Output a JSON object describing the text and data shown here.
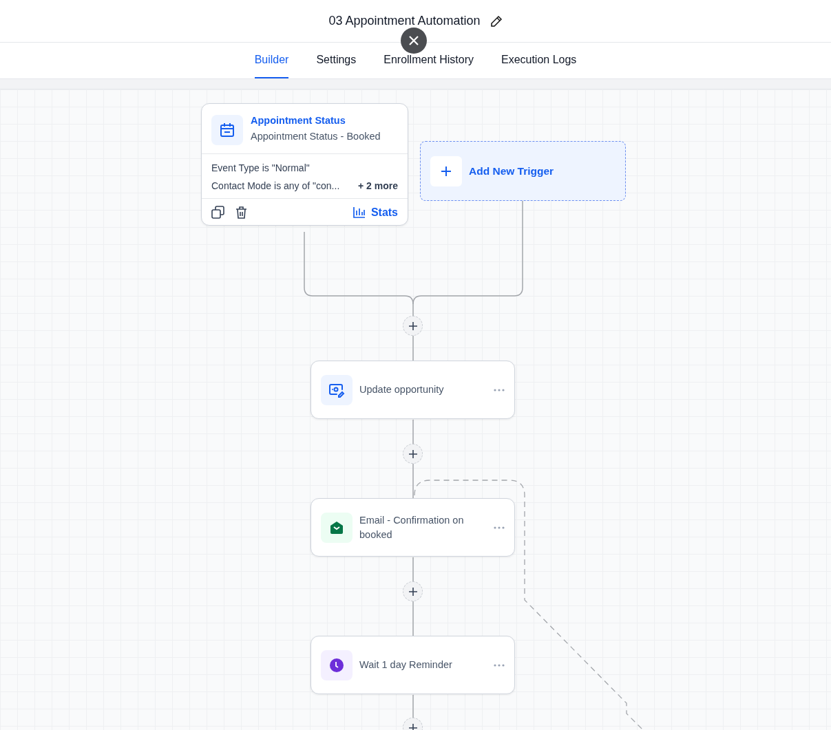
{
  "header": {
    "title": "03 Appointment Automation"
  },
  "tabs": [
    {
      "label": "Builder",
      "selected": true
    },
    {
      "label": "Settings",
      "selected": false
    },
    {
      "label": "Enrollment History",
      "selected": false
    },
    {
      "label": "Execution Logs",
      "selected": false
    }
  ],
  "trigger": {
    "title": "Appointment Status",
    "subtitle": "Appointment Status - Booked",
    "conditions": [
      "Event Type is \"Normal\"",
      "Contact Mode is any of \"con..."
    ],
    "more": "+ 2 more",
    "stats": "Stats"
  },
  "add_trigger": {
    "label": "Add New Trigger"
  },
  "actions": [
    {
      "kind": "update",
      "label": "Update opportunity"
    },
    {
      "kind": "email",
      "label": "Email - Confirmation on booked"
    },
    {
      "kind": "wait",
      "label": "Wait 1 day Reminder"
    }
  ]
}
